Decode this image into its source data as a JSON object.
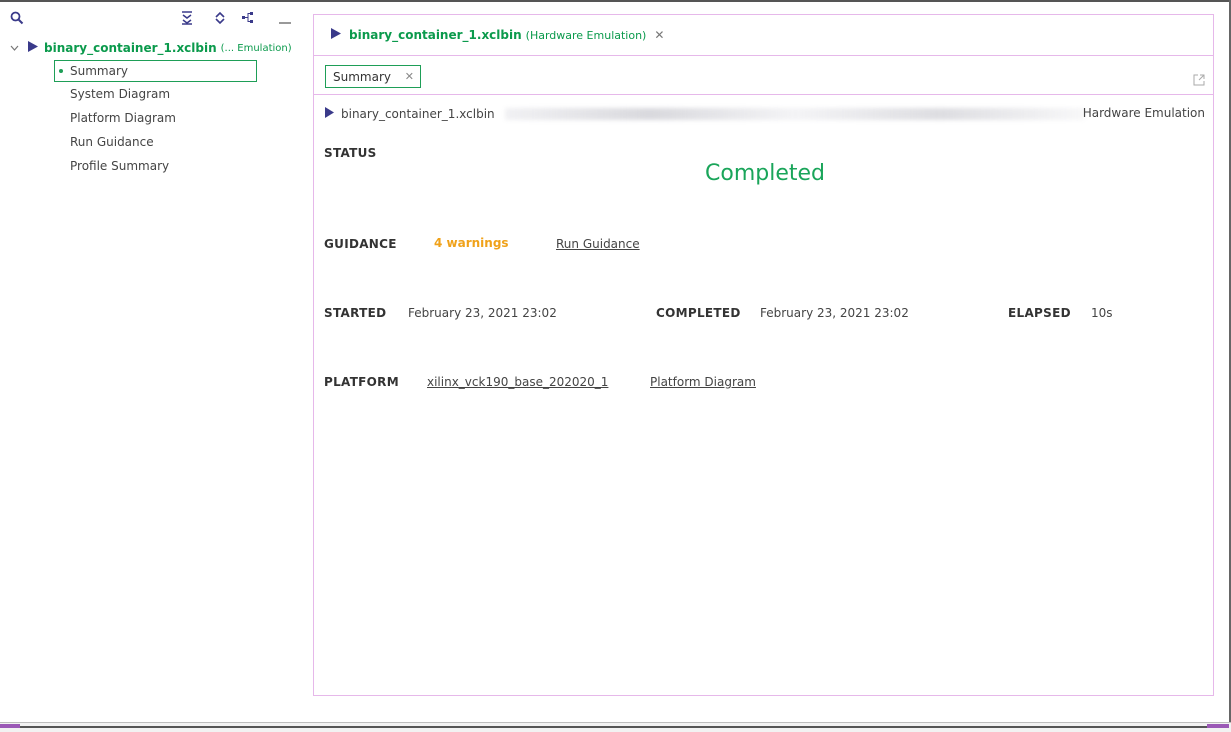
{
  "sidebar": {
    "root": {
      "name": "binary_container_1.xclbin",
      "subtitle": "(... Emulation)"
    },
    "items": [
      {
        "label": "Summary"
      },
      {
        "label": "System Diagram"
      },
      {
        "label": "Platform Diagram"
      },
      {
        "label": "Run Guidance"
      },
      {
        "label": "Profile Summary"
      }
    ]
  },
  "panel": {
    "title": "binary_container_1.xclbin",
    "subtitle": "(Hardware Emulation)",
    "close_glyph": "✕",
    "tab": {
      "label": "Summary",
      "close_glyph": "✕"
    }
  },
  "summary": {
    "path_name": "binary_container_1.xclbin",
    "mode": "Hardware Emulation",
    "status_label": "STATUS",
    "status_value": "Completed",
    "guidance_label": "GUIDANCE",
    "warnings": "4 warnings",
    "run_guidance_link": "Run Guidance",
    "started_label": "STARTED",
    "started_value": "February 23, 2021 23:02",
    "completed_label": "COMPLETED",
    "completed_value": "February 23, 2021 23:02",
    "elapsed_label": "ELAPSED",
    "elapsed_value": "10s",
    "platform_label": "PLATFORM",
    "platform_value": "xilinx_vck190_base_202020_1",
    "platform_diagram_link": "Platform Diagram"
  },
  "colors": {
    "accent_green": "#1aa55a",
    "warning_orange": "#f0a21a",
    "panel_border": "#e6b8ea",
    "icon_blue": "#3a3a8a"
  },
  "icons": {
    "toolbar": [
      "search-icon",
      "collapse-all-icon",
      "expand-all-icon",
      "tree-layout-icon",
      "minimize-icon"
    ],
    "run": "play-icon",
    "popout": "popout-icon"
  }
}
